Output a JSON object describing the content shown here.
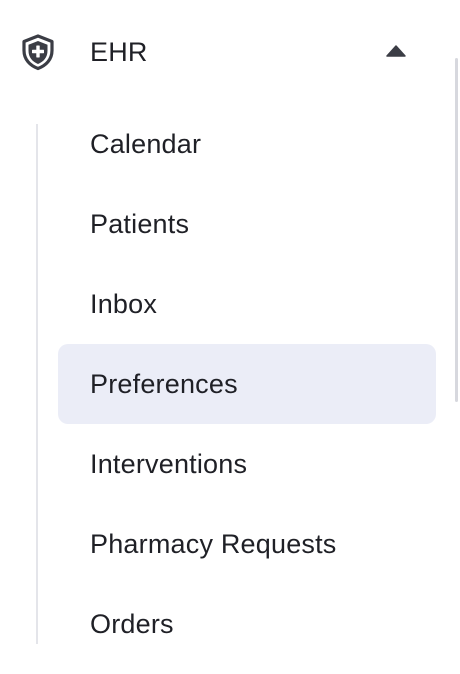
{
  "section": {
    "title": "EHR",
    "icon": "shield-plus-icon",
    "toggle_icon": "caret-up-icon",
    "expanded": true
  },
  "nav": {
    "items": [
      {
        "label": "Calendar",
        "active": false
      },
      {
        "label": "Patients",
        "active": false
      },
      {
        "label": "Inbox",
        "active": false
      },
      {
        "label": "Preferences",
        "active": true
      },
      {
        "label": "Interventions",
        "active": false
      },
      {
        "label": "Pharmacy Requests",
        "active": false
      },
      {
        "label": "Orders",
        "active": false
      }
    ]
  },
  "colors": {
    "text": "#1f2026",
    "icon": "#3b3d45",
    "active_background": "#ebedf7",
    "tree_line": "#e4e5ea"
  }
}
